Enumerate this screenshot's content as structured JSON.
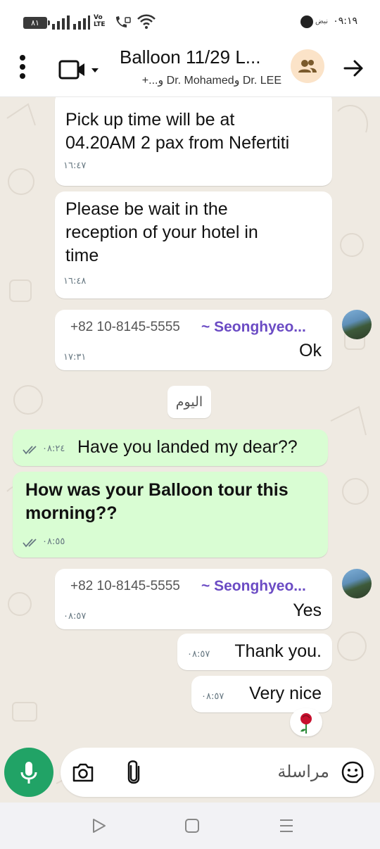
{
  "status_bar": {
    "battery": "٨١",
    "volte": "Vo",
    "lte": "LTE",
    "pulse": "نبض",
    "time": "٠٩:١٩"
  },
  "header": {
    "title": "Balloon 11/29 L...",
    "subtitle": "Dr. LEE وDr. Mohamed و...+",
    "icons": [
      "menu-icon",
      "video-call-icon",
      "group-avatar-icon",
      "forward-arrow-icon"
    ]
  },
  "messages": [
    {
      "direction": "in",
      "text_lines": [
        "Pick up time will be at",
        "04.20AM 2 pax from Nefertiti"
      ],
      "time": "١٦:٤٧"
    },
    {
      "direction": "in",
      "text_lines": [
        "Please be wait in the",
        "reception of your hotel in",
        "time"
      ],
      "time": "١٦:٤٨"
    },
    {
      "direction": "in",
      "sender_phone": "+82 10-8145-5555",
      "sender_name": "~ Seonghyeo...",
      "text": "Ok",
      "time": "١٧:٣١"
    },
    {
      "direction": "out",
      "text": "Have you landed my dear??",
      "time": "٠٨:٢٤",
      "status": "read"
    },
    {
      "direction": "out",
      "text_lines": [
        "How was your Balloon tour this",
        "morning??"
      ],
      "time": "٠٨:٥٥",
      "status": "read"
    },
    {
      "direction": "in",
      "sender_phone": "+82 10-8145-5555",
      "sender_name": "~ Seonghyeo...",
      "text": "Yes",
      "time": "٠٨:٥٧"
    },
    {
      "direction": "in",
      "text": "Thank you.",
      "time": "٠٨:٥٧"
    },
    {
      "direction": "in",
      "text": "Very nice",
      "time": "٠٨:٥٧",
      "reaction": "rose"
    }
  ],
  "date_divider": "اليوم",
  "composer": {
    "placeholder": "مراسلة",
    "icons": [
      "mic-icon",
      "camera-icon",
      "attach-icon",
      "sticker-icon"
    ]
  },
  "nav_bar": {
    "icons": [
      "back-icon",
      "home-icon",
      "recents-icon"
    ]
  },
  "colors": {
    "chat_bg": "#efeae2",
    "incoming_bubble": "#ffffff",
    "outgoing_bubble": "#d9fdd3",
    "sender_name": "#6b4bc4",
    "mic_green": "#21a366",
    "read_ticks": "#667781"
  }
}
